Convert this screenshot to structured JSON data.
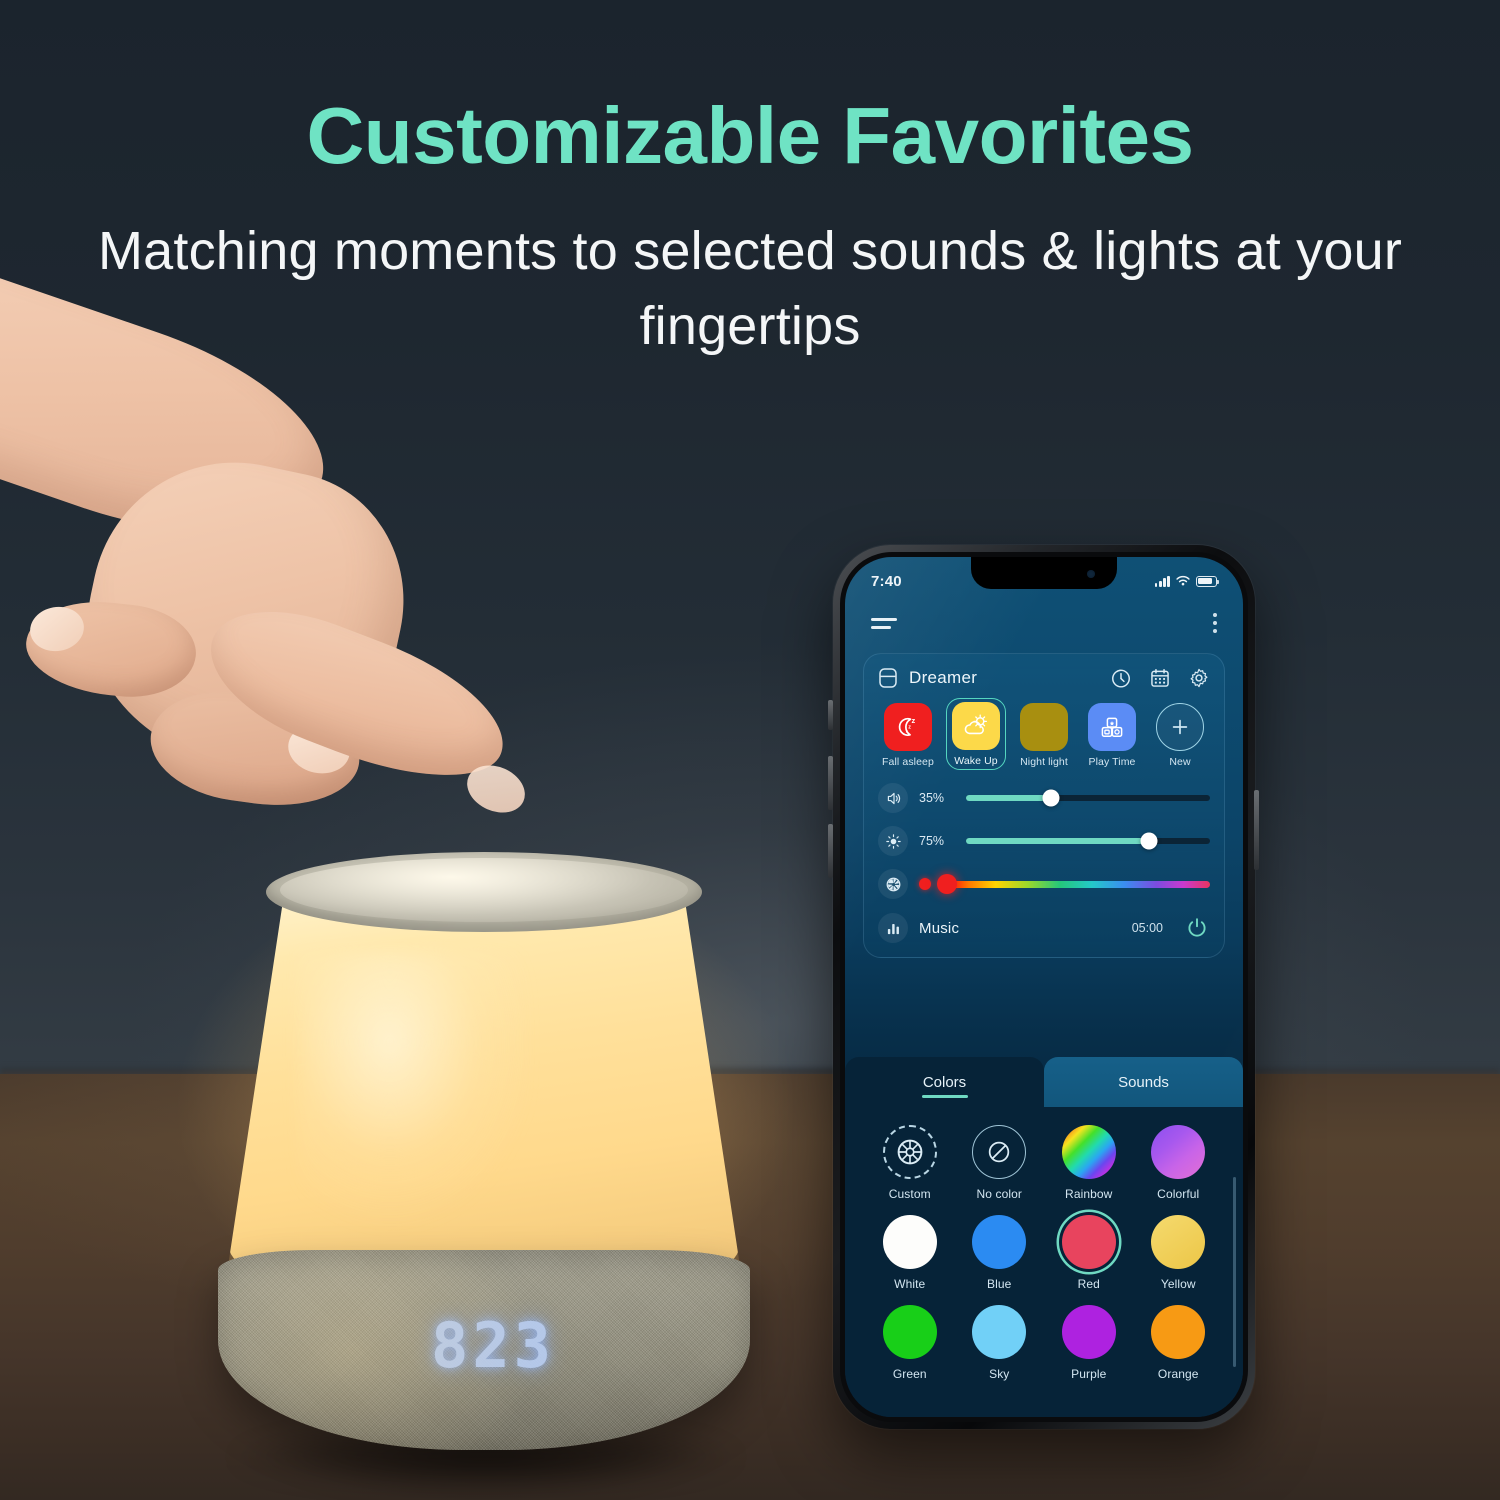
{
  "hero": {
    "headline": "Customizable Favorites",
    "subheadline": "Matching moments to selected sounds & lights at your fingertips",
    "headline_color": "#6fe3c4",
    "background_color": "#1f2831",
    "table_color": "#55422f"
  },
  "lamp": {
    "clock_display": "823",
    "light_color": "#ffdf9b",
    "base_color": "#9d9a88"
  },
  "phone": {
    "statusbar": {
      "time": "7:40",
      "signal_icon": "cellular-bars-icon",
      "wifi_icon": "wifi-icon",
      "battery_icon": "battery-icon"
    },
    "appbar": {
      "menu_icon": "hamburger-menu-icon",
      "overflow_icon": "kebab-menu-icon"
    },
    "device": {
      "icon": "speaker-device-icon",
      "name": "Dreamer",
      "actions": [
        {
          "name": "timer-icon",
          "label": "Timer"
        },
        {
          "name": "calendar-icon",
          "label": "Schedule"
        },
        {
          "name": "gear-icon",
          "label": "Settings"
        }
      ],
      "scenes": [
        {
          "label": "Fall asleep",
          "color": "#f01f1f",
          "icon": "moon-zzz-icon",
          "selected": false
        },
        {
          "label": "Wake Up",
          "color": "#fcd949",
          "icon": "sun-cloud-icon",
          "selected": true
        },
        {
          "label": "Night light",
          "color": "#a88f10",
          "icon": "none",
          "selected": false
        },
        {
          "label": "Play Time",
          "color": "#5b8cf5",
          "icon": "toy-blocks-icon",
          "selected": false
        },
        {
          "label": "New",
          "color": "transparent",
          "icon": "plus-icon",
          "selected": false
        }
      ],
      "controls": {
        "volume": {
          "icon": "speaker-volume-icon",
          "value": "35%",
          "percent": 35
        },
        "brightness": {
          "icon": "brightness-sun-icon",
          "value": "75%",
          "percent": 75
        },
        "color": {
          "icon": "color-wheel-icon",
          "current_color": "#f01f1f",
          "knob_percent": 2
        },
        "music": {
          "icon": "equalizer-bars-icon",
          "label": "Music",
          "timer": "05:00",
          "power_icon": "power-icon"
        }
      }
    },
    "tabs": [
      {
        "label": "Colors",
        "active": true
      },
      {
        "label": "Sounds",
        "active": false
      }
    ],
    "swatches": [
      {
        "label": "Custom",
        "type": "dashed-wheel",
        "icon": "color-wheel-icon",
        "color": "transparent",
        "selected": false
      },
      {
        "label": "No color",
        "type": "outline",
        "icon": "no-color-slash-icon",
        "color": "transparent",
        "selected": false
      },
      {
        "label": "Rainbow",
        "type": "gradient",
        "color": "rainbow",
        "selected": false
      },
      {
        "label": "Colorful",
        "type": "gradient",
        "color": "#b862e8",
        "selected": false
      },
      {
        "label": "White",
        "type": "solid",
        "color": "#fdfdfb",
        "selected": false
      },
      {
        "label": "Blue",
        "type": "solid",
        "color": "#2b8bf2",
        "selected": false
      },
      {
        "label": "Red",
        "type": "solid",
        "color": "#e8445e",
        "selected": true
      },
      {
        "label": "Yellow",
        "type": "solid",
        "color": "#f2d05e",
        "selected": false
      },
      {
        "label": "Green",
        "type": "solid",
        "color": "#18cf18",
        "selected": false
      },
      {
        "label": "Sky",
        "type": "solid",
        "color": "#71d0f7",
        "selected": false
      },
      {
        "label": "Purple",
        "type": "solid",
        "color": "#ae22e0",
        "selected": false
      },
      {
        "label": "Orange",
        "type": "solid",
        "color": "#f79a14",
        "selected": false
      }
    ]
  }
}
